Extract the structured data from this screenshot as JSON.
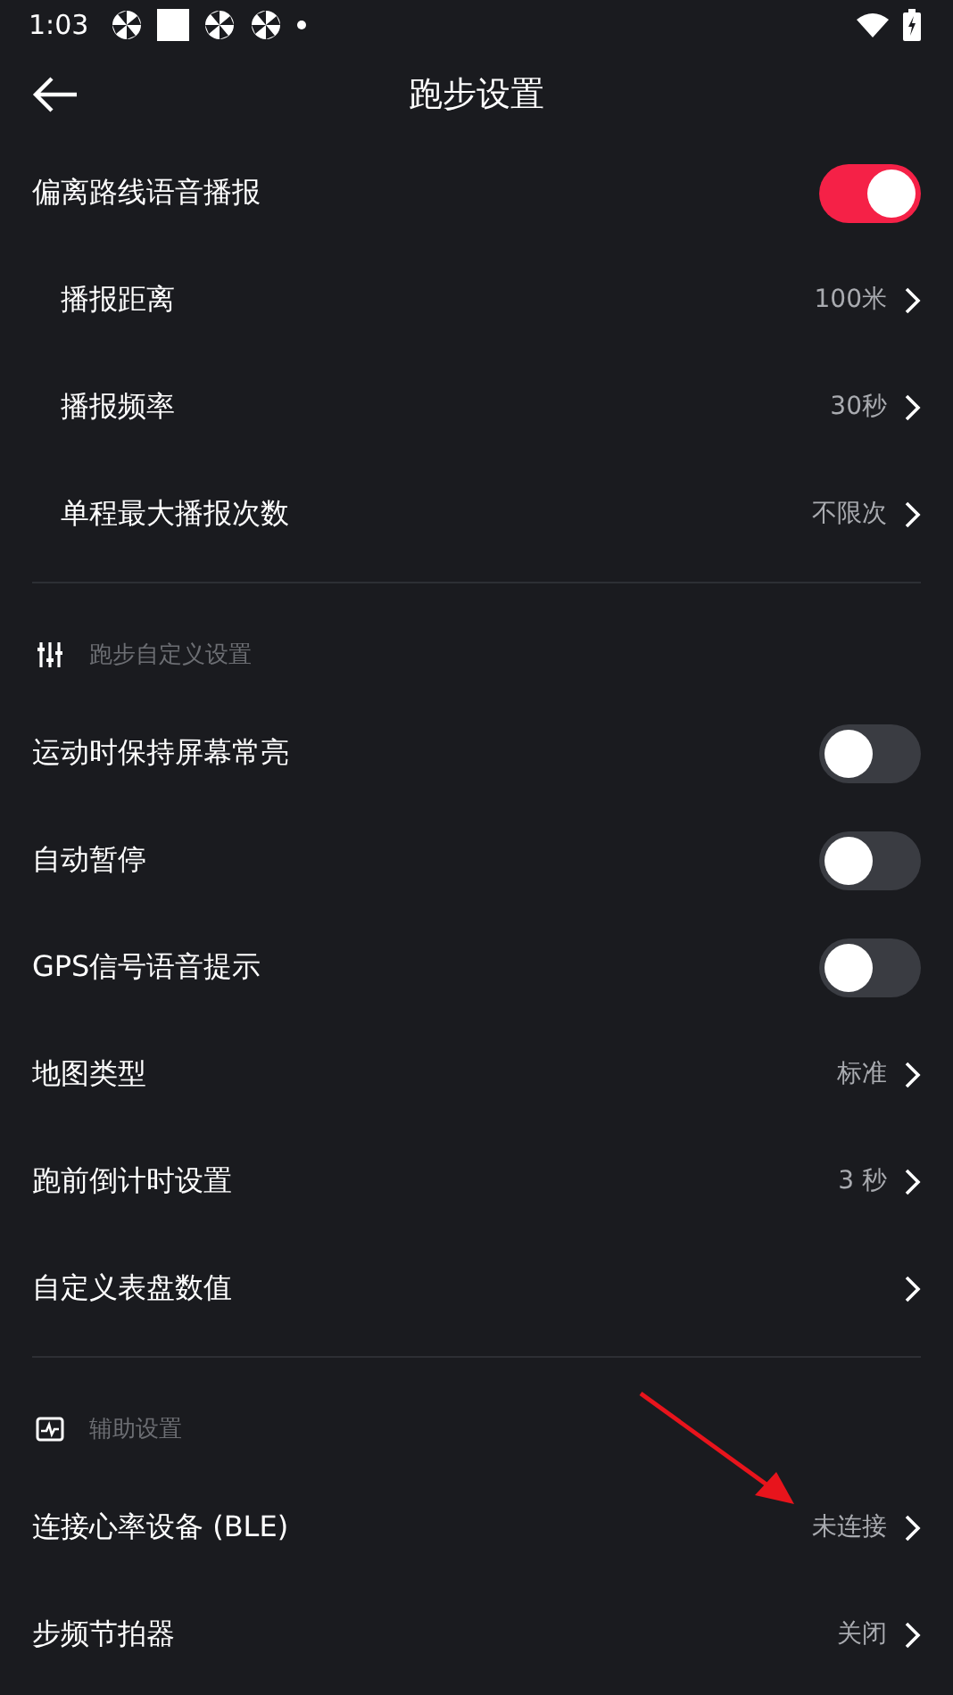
{
  "status_bar": {
    "time": "1:03"
  },
  "header": {
    "title": "跑步设置"
  },
  "sections": [
    {
      "items": [
        {
          "kind": "toggle",
          "label": "偏离路线语音播报",
          "on": true,
          "children": [
            {
              "kind": "link",
              "label": "播报距离",
              "value": "100米"
            },
            {
              "kind": "link",
              "label": "播报频率",
              "value": "30秒"
            },
            {
              "kind": "link",
              "label": "单程最大播报次数",
              "value": "不限次"
            }
          ]
        }
      ]
    },
    {
      "heading": "跑步自定义设置",
      "items": [
        {
          "kind": "toggle",
          "label": "运动时保持屏幕常亮",
          "on": false
        },
        {
          "kind": "toggle",
          "label": "自动暂停",
          "on": false
        },
        {
          "kind": "toggle",
          "label": "GPS信号语音提示",
          "on": false
        },
        {
          "kind": "link",
          "label": "地图类型",
          "value": "标准"
        },
        {
          "kind": "link",
          "label": "跑前倒计时设置",
          "value": "3 秒"
        },
        {
          "kind": "link",
          "label": "自定义表盘数值"
        }
      ]
    },
    {
      "heading": "辅助设置",
      "items": [
        {
          "kind": "link",
          "label": "连接心率设备 (BLE)",
          "value": "未连接"
        },
        {
          "kind": "link",
          "label": "步频节拍器",
          "value": "关闭"
        }
      ]
    }
  ],
  "annotation": {
    "kind": "arrow"
  }
}
